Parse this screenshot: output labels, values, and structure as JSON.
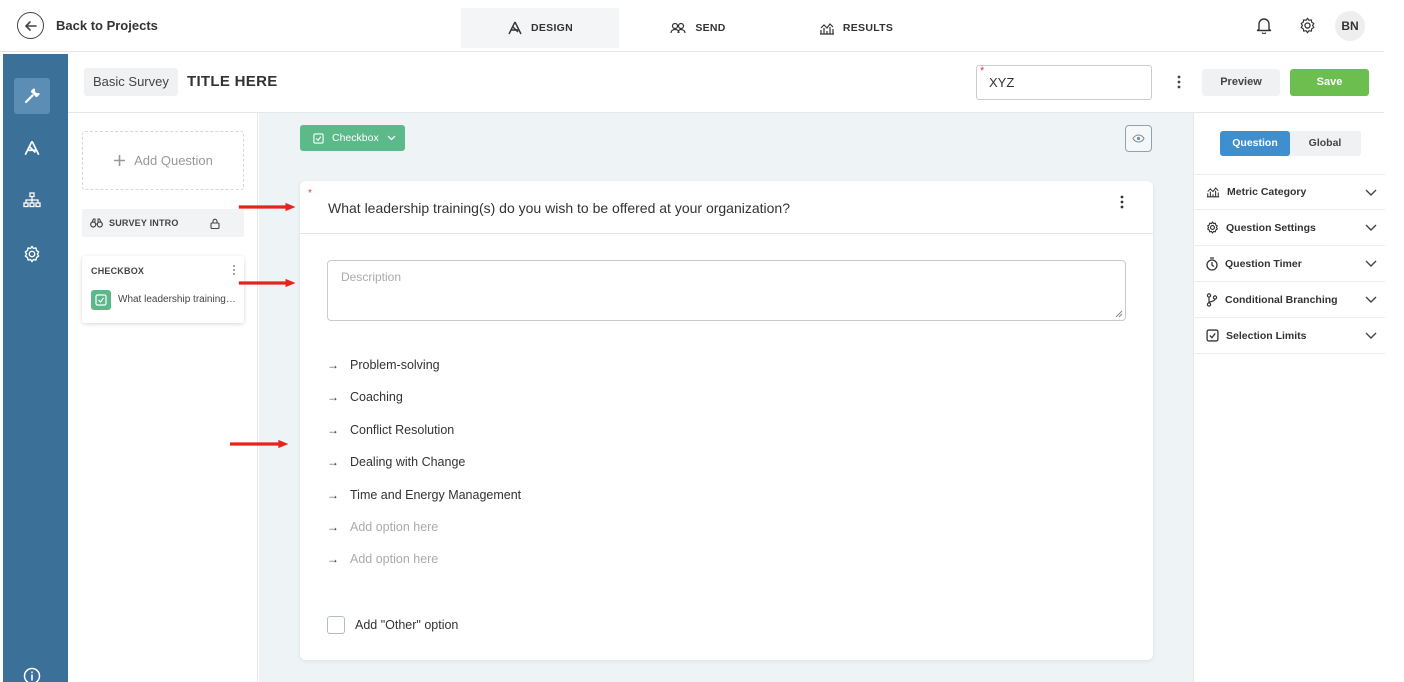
{
  "topbar": {
    "back_label": "Back to Projects",
    "tabs": [
      {
        "label": "DESIGN",
        "icon": "design-icon",
        "active": true
      },
      {
        "label": "SEND",
        "icon": "users-icon",
        "active": false
      },
      {
        "label": "RESULTS",
        "icon": "results-icon",
        "active": false
      }
    ],
    "avatar_initials": "BN"
  },
  "header": {
    "survey_type": "Basic Survey",
    "title": "TITLE HERE",
    "code_field_value": "XYZ",
    "preview_label": "Preview",
    "save_label": "Save"
  },
  "left_panel": {
    "add_question_label": "Add Question",
    "survey_intro_label": "SURVEY INTRO",
    "question_card": {
      "type_label": "CHECKBOX",
      "text": "What leadership training(s) do you wish to be offered at your organization?"
    }
  },
  "editor": {
    "type_selector": "Checkbox",
    "question_text": "What leadership training(s) do you wish to be offered at your organization?",
    "description_placeholder": "Description",
    "options": [
      "Problem-solving",
      "Coaching",
      "Conflict Resolution",
      "Dealing with Change",
      "Time and Energy Management"
    ],
    "option_placeholders": [
      "Add option here",
      "Add option here"
    ],
    "other_option_label": "Add \"Other\" option"
  },
  "right_panel": {
    "toggle": [
      {
        "label": "Question",
        "active": true
      },
      {
        "label": "Global",
        "active": false
      }
    ],
    "sections": [
      {
        "label": "Metric Category",
        "icon": "metric-icon"
      },
      {
        "label": "Question Settings",
        "icon": "gear-icon"
      },
      {
        "label": "Question Timer",
        "icon": "timer-icon"
      },
      {
        "label": "Conditional Branching",
        "icon": "branch-icon"
      },
      {
        "label": "Selection Limits",
        "icon": "checkbox-icon"
      }
    ]
  },
  "colors": {
    "rail": "#3b7099",
    "save": "#6cbe4f",
    "accent_green": "#5bb98a",
    "toggle_active": "#3f8fce",
    "annotation_red": "#e8231c"
  }
}
